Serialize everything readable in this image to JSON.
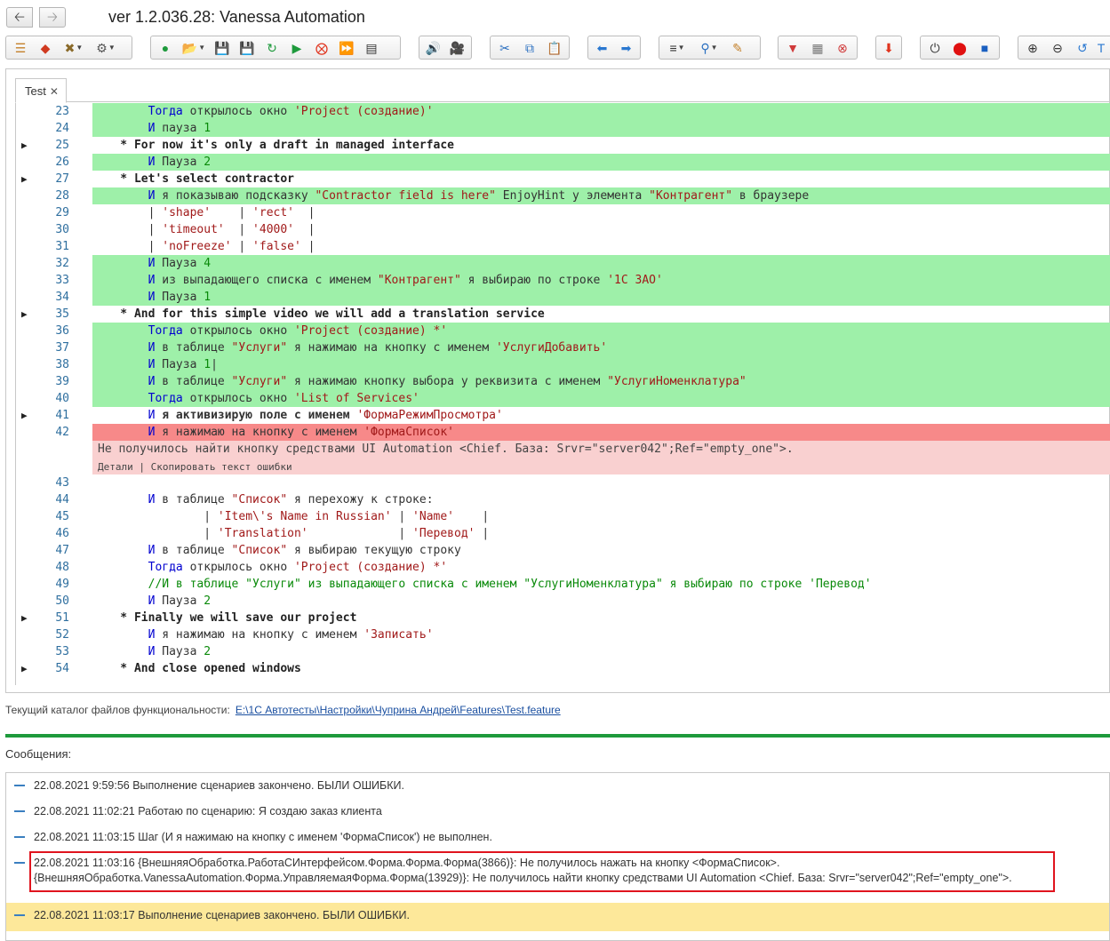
{
  "window": {
    "back_icon": "arrow-left-icon",
    "forward_icon": "arrow-right-icon",
    "title": "ver 1.2.036.28: Vanessa Automation"
  },
  "editor": {
    "tab_label": "Test",
    "tab_close": "✕",
    "lines": [
      {
        "num": "23",
        "style": "green",
        "arrow": false,
        "parts": [
          [
            "kw",
            "        Тогда"
          ],
          [
            "",
            " открылось окно "
          ],
          [
            "str",
            "'Project (создание)'"
          ]
        ]
      },
      {
        "num": "24",
        "style": "green",
        "arrow": false,
        "parts": [
          [
            "kw",
            "        И"
          ],
          [
            "",
            " пауза "
          ],
          [
            "n",
            "1"
          ]
        ]
      },
      {
        "num": "25",
        "style": "plain",
        "arrow": true,
        "parts": [
          [
            "hdr",
            "    * For now it's only a draft in managed interface"
          ]
        ]
      },
      {
        "num": "26",
        "style": "green",
        "arrow": false,
        "parts": [
          [
            "kw",
            "        И"
          ],
          [
            "",
            " Пауза "
          ],
          [
            "n",
            "2"
          ]
        ]
      },
      {
        "num": "27",
        "style": "plain",
        "arrow": true,
        "parts": [
          [
            "hdr",
            "    * Let's select contractor"
          ]
        ]
      },
      {
        "num": "28",
        "style": "green",
        "arrow": false,
        "parts": [
          [
            "kw",
            "        И"
          ],
          [
            "",
            " я показываю подсказку "
          ],
          [
            "str",
            "\"Contractor field is here\""
          ],
          [
            "",
            " EnjoyHint у элемента "
          ],
          [
            "str",
            "\"Контрагент\""
          ],
          [
            "",
            " в браузере"
          ]
        ]
      },
      {
        "num": "29",
        "style": "plain",
        "arrow": false,
        "parts": [
          [
            "",
            "        | "
          ],
          [
            "str",
            "'shape'"
          ],
          [
            "",
            "    | "
          ],
          [
            "str",
            "'rect'"
          ],
          [
            "",
            "  |"
          ]
        ]
      },
      {
        "num": "30",
        "style": "plain",
        "arrow": false,
        "parts": [
          [
            "",
            "        | "
          ],
          [
            "str",
            "'timeout'"
          ],
          [
            "",
            "  | "
          ],
          [
            "str",
            "'4000'"
          ],
          [
            "",
            "  |"
          ]
        ]
      },
      {
        "num": "31",
        "style": "plain",
        "arrow": false,
        "parts": [
          [
            "",
            "        | "
          ],
          [
            "str",
            "'noFreeze'"
          ],
          [
            "",
            " | "
          ],
          [
            "str",
            "'false'"
          ],
          [
            "",
            " |"
          ]
        ]
      },
      {
        "num": "32",
        "style": "green",
        "arrow": false,
        "parts": [
          [
            "kw",
            "        И"
          ],
          [
            "",
            " Пауза "
          ],
          [
            "n",
            "4"
          ]
        ]
      },
      {
        "num": "33",
        "style": "green",
        "arrow": false,
        "parts": [
          [
            "kw",
            "        И"
          ],
          [
            "",
            " из выпадающего списка с именем "
          ],
          [
            "str",
            "\"Контрагент\""
          ],
          [
            "",
            " я выбираю по строке "
          ],
          [
            "str",
            "'1С ЗАО'"
          ]
        ]
      },
      {
        "num": "34",
        "style": "green",
        "arrow": false,
        "parts": [
          [
            "kw",
            "        И"
          ],
          [
            "",
            " Пауза "
          ],
          [
            "n",
            "1"
          ]
        ]
      },
      {
        "num": "35",
        "style": "plain",
        "arrow": true,
        "parts": [
          [
            "hdr",
            "    * And for this simple video we will add a translation service"
          ]
        ]
      },
      {
        "num": "36",
        "style": "green",
        "arrow": false,
        "parts": [
          [
            "kw",
            "        Тогда"
          ],
          [
            "",
            " открылось окно "
          ],
          [
            "str",
            "'Project (создание) *'"
          ]
        ]
      },
      {
        "num": "37",
        "style": "green",
        "arrow": false,
        "parts": [
          [
            "kw",
            "        И"
          ],
          [
            "",
            " в таблице "
          ],
          [
            "str",
            "\"Услуги\""
          ],
          [
            "",
            " я нажимаю на кнопку с именем "
          ],
          [
            "str",
            "'УслугиДобавить'"
          ]
        ]
      },
      {
        "num": "38",
        "style": "green",
        "arrow": false,
        "parts": [
          [
            "kw",
            "        И"
          ],
          [
            "",
            " Пауза "
          ],
          [
            "n",
            "1"
          ],
          [
            "",
            "|"
          ]
        ]
      },
      {
        "num": "39",
        "style": "green",
        "arrow": false,
        "parts": [
          [
            "kw",
            "        И"
          ],
          [
            "",
            " в таблице "
          ],
          [
            "str",
            "\"Услуги\""
          ],
          [
            "",
            " я нажимаю кнопку выбора у реквизита с именем "
          ],
          [
            "str",
            "\"УслугиНоменклатура\""
          ]
        ]
      },
      {
        "num": "40",
        "style": "green",
        "arrow": false,
        "parts": [
          [
            "kw",
            "        Тогда"
          ],
          [
            "",
            " открылось окно "
          ],
          [
            "str",
            "'List of Services'"
          ]
        ]
      },
      {
        "num": "41",
        "style": "plain",
        "arrow": true,
        "parts": [
          [
            "kw",
            "        И"
          ],
          [
            "bold",
            " я активизирую поле с именем "
          ],
          [
            "str",
            "'ФормаРежимПросмотра'"
          ]
        ]
      },
      {
        "num": "42",
        "style": "red",
        "arrow": false,
        "parts": [
          [
            "kw",
            "        И"
          ],
          [
            "",
            " я нажимаю на кнопку с именем "
          ],
          [
            "str",
            "'ФормаСписок'"
          ]
        ]
      },
      {
        "num": "43",
        "style": "plain",
        "arrow": false,
        "parts": []
      },
      {
        "num": "44",
        "style": "plain",
        "arrow": false,
        "parts": [
          [
            "kw",
            "        И"
          ],
          [
            "",
            " в таблице "
          ],
          [
            "str",
            "\"Список\""
          ],
          [
            "",
            " я перехожу к строке:"
          ]
        ]
      },
      {
        "num": "45",
        "style": "plain",
        "arrow": false,
        "parts": [
          [
            "",
            "                | "
          ],
          [
            "str",
            "'Item\\'s Name in Russian'"
          ],
          [
            "",
            " | "
          ],
          [
            "str",
            "'Name'"
          ],
          [
            "",
            "    |"
          ]
        ]
      },
      {
        "num": "46",
        "style": "plain",
        "arrow": false,
        "parts": [
          [
            "",
            "                | "
          ],
          [
            "str",
            "'Translation'"
          ],
          [
            "",
            "             | "
          ],
          [
            "str",
            "'Перевод'"
          ],
          [
            "",
            " |"
          ]
        ]
      },
      {
        "num": "47",
        "style": "plain",
        "arrow": false,
        "parts": [
          [
            "kw",
            "        И"
          ],
          [
            "",
            " в таблице "
          ],
          [
            "str",
            "\"Список\""
          ],
          [
            "",
            " я выбираю текущую строку"
          ]
        ]
      },
      {
        "num": "48",
        "style": "plain",
        "arrow": false,
        "parts": [
          [
            "kw",
            "        Тогда"
          ],
          [
            "",
            " открылось окно "
          ],
          [
            "str",
            "'Project (создание) *'"
          ]
        ]
      },
      {
        "num": "49",
        "style": "plain",
        "arrow": false,
        "parts": [
          [
            "cm",
            "        //И в таблице \"Услуги\" из выпадающего списка с именем \"УслугиНоменклатура\" я выбираю по строке 'Перевод'"
          ]
        ]
      },
      {
        "num": "50",
        "style": "plain",
        "arrow": false,
        "parts": [
          [
            "kw",
            "        И"
          ],
          [
            "",
            " Пауза "
          ],
          [
            "n",
            "2"
          ]
        ]
      },
      {
        "num": "51",
        "style": "plain",
        "arrow": true,
        "parts": [
          [
            "hdr",
            "    * Finally we will save our project"
          ]
        ]
      },
      {
        "num": "52",
        "style": "plain",
        "arrow": false,
        "parts": [
          [
            "kw",
            "        И"
          ],
          [
            "",
            " я нажимаю на кнопку с именем "
          ],
          [
            "str",
            "'Записать'"
          ]
        ]
      },
      {
        "num": "53",
        "style": "plain",
        "arrow": false,
        "parts": [
          [
            "kw",
            "        И"
          ],
          [
            "",
            " Пауза "
          ],
          [
            "n",
            "2"
          ]
        ]
      },
      {
        "num": "54",
        "style": "plain",
        "arrow": true,
        "parts": [
          [
            "hdr",
            "    * And close opened windows"
          ]
        ]
      }
    ],
    "error": {
      "message": "Не получилось найти кнопку средствами UI Automation <Chief. База: Srvr=\"server042\";Ref=\"empty_one\">.",
      "details_link": "Детали",
      "separator": " | ",
      "copy_link": "Скопировать текст ошибки"
    }
  },
  "path": {
    "label": "Текущий каталог файлов функциональности:",
    "value": "E:\\1С Автотесты\\Настройки\\Чуприна Андрей\\Features\\Test.feature"
  },
  "messages": {
    "header": "Сообщения:",
    "items": [
      {
        "text": "22.08.2021 9:59:56 Выполнение сценариев закончено. БЫЛИ ОШИБКИ."
      },
      {
        "text": "22.08.2021 11:02:21 Работаю по сценарию: Я создаю заказ клиента"
      },
      {
        "text": "22.08.2021 11:03:15 Шаг (И я нажимаю на кнопку с именем 'ФормаСписок') не выполнен."
      },
      {
        "text": "22.08.2021 11:03:16 {ВнешняяОбработка.РаботаСИнтерфейсом.Форма.Форма.Форма(3866)}: Не получилось нажать на кнопку <ФормаСписок>.\n{ВнешняяОбработка.VanessaAutomation.Форма.УправляемаяФорма.Форма(13929)}: Не получилось найти кнопку средствами UI Automation <Chief. База: Srvr=\"server042\";Ref=\"empty_one\">."
      },
      {
        "text": "22.08.2021 11:03:17 Выполнение сценариев закончено. БЫЛИ ОШИБКИ."
      }
    ]
  },
  "colors": {
    "success_line": "#9ef0a9",
    "error_line": "#f78989",
    "error_box": "#f9d0d0",
    "highlight_msg": "#fde89a",
    "accent_green": "#1e9a3c",
    "error_frame": "#e0141e"
  }
}
